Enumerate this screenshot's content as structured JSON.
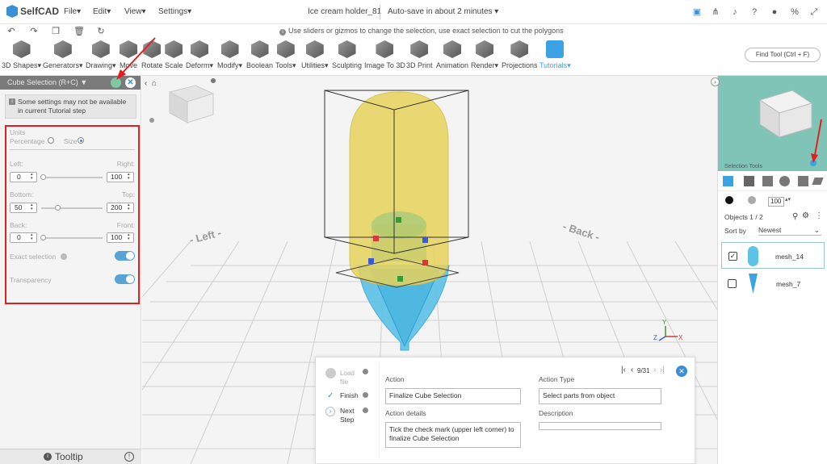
{
  "topbar": {
    "app_name": "SelfCAD",
    "menus": [
      "File",
      "Edit",
      "View",
      "Settings"
    ],
    "document_title": "Ice cream holder_81",
    "autosave": "Auto-save in about 2 minutes",
    "hint": "Use sliders or gizmos to change the selection, use exact selection to cut the polygons"
  },
  "toolbar": {
    "tools": [
      "3D Shapes",
      "Generators",
      "Drawing",
      "Move",
      "Rotate",
      "Scale",
      "Deform",
      "Modify",
      "Boolean",
      "Tools",
      "Utilities",
      "Sculpting",
      "Image To 3D",
      "3D Print",
      "Animation",
      "Render",
      "Projections",
      "Tutorials"
    ],
    "find_tool_placeholder": "Find Tool (Ctrl + F)"
  },
  "left_panel": {
    "title": "Cube Selection (R+C)",
    "note": "Some settings may not be available in current Tutorial step",
    "units_label": "Units",
    "percentage_label": "Percentage",
    "size_label": "Size",
    "units_selected": "Size",
    "left_label": "Left:",
    "right_label": "Right:",
    "left_value": "0",
    "right_value": "100",
    "bottom_label": "Bottom:",
    "top_label": "Top:",
    "bottom_value": "50",
    "top_value": "200",
    "back_label": "Back:",
    "front_label": "Front:",
    "back_value": "0",
    "front_value": "100",
    "exact_selection_label": "Exact selection",
    "exact_selection_on": true,
    "transparency_label": "Transparency",
    "transparency_on": true,
    "tooltip_label": "Tooltip"
  },
  "viewport": {
    "label_left": "Left",
    "label_back": "Back",
    "axis_x": "X",
    "axis_y": "Y",
    "axis_z": "Z"
  },
  "right_panel": {
    "selection_tools_label": "Selection Tools",
    "opacity_value": "100",
    "objects_count": "Objects 1 / 2",
    "sort_by_label": "Sort by",
    "sort_value": "Newest",
    "objects": [
      {
        "name": "mesh_14",
        "checked": true
      },
      {
        "name": "mesh_7",
        "checked": false
      }
    ]
  },
  "tutorial": {
    "steps": [
      {
        "label": "Load file",
        "state": "pending"
      },
      {
        "label": "Finish",
        "state": "done"
      },
      {
        "label": "Next Step",
        "state": "next"
      }
    ],
    "page": "9/31",
    "action_label": "Action",
    "action_value": "Finalize Cube Selection",
    "action_details_label": "Action details",
    "action_details_value": "Tick the check mark (upper left corner) to finalize Cube Selection",
    "action_type_label": "Action Type",
    "action_type_value": "Select parts from object",
    "description_label": "Description",
    "description_value": ""
  },
  "colors": {
    "accent": "#3a8fd6",
    "highlight_red": "#e02020",
    "yellow_shape": "#e8d35c",
    "cyan_shape": "#5cc2e6"
  }
}
